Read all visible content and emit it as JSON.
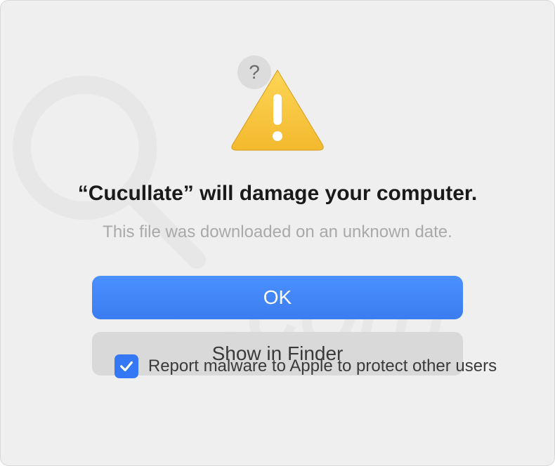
{
  "dialog": {
    "title": "“Cucullate” will damage your computer.",
    "subtitle": "This file was downloaded on an unknown date.",
    "ok_label": "OK",
    "show_in_finder_label": "Show in Finder",
    "report_malware_label": "Report malware to Apple to protect other users",
    "report_checked": true,
    "help_glyph": "?"
  }
}
